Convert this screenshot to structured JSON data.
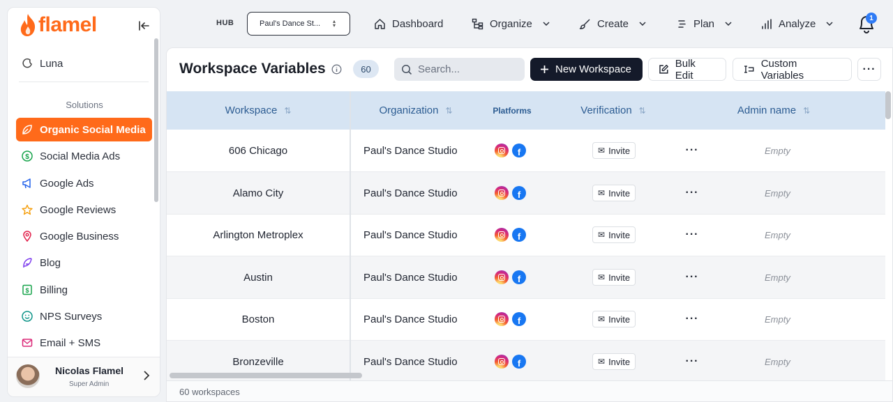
{
  "app": {
    "logo_text": "flamel",
    "brand_color": "#ff6a1a"
  },
  "sidebar": {
    "top_item": {
      "label": "Luna",
      "icon": "moon-icon"
    },
    "section_label": "Solutions",
    "items": [
      {
        "label": "Organic Social Media",
        "icon": "leaf-icon",
        "active": true
      },
      {
        "label": "Social Media Ads",
        "icon": "dollar-icon"
      },
      {
        "label": "Google Ads",
        "icon": "megaphone-icon"
      },
      {
        "label": "Google Reviews",
        "icon": "star-icon"
      },
      {
        "label": "Google Business",
        "icon": "map-pin-icon"
      },
      {
        "label": "Blog",
        "icon": "feather-icon"
      },
      {
        "label": "Billing",
        "icon": "bill-icon"
      },
      {
        "label": "NPS Surveys",
        "icon": "smile-icon"
      },
      {
        "label": "Email + SMS",
        "icon": "mail-icon"
      }
    ],
    "user": {
      "name": "Nicolas Flamel",
      "role": "Super Admin"
    }
  },
  "topbar": {
    "hub_label": "HUB",
    "hub_value": "Paul's Dance St...",
    "nav": [
      {
        "label": "Dashboard",
        "icon": "home-icon"
      },
      {
        "label": "Organize",
        "icon": "organize-icon"
      },
      {
        "label": "Create",
        "icon": "brush-icon"
      },
      {
        "label": "Plan",
        "icon": "list-icon"
      },
      {
        "label": "Analyze",
        "icon": "bar-chart-icon"
      }
    ],
    "notifications_count": "1"
  },
  "main": {
    "title": "Workspace Variables",
    "count": "60",
    "search_placeholder": "Search...",
    "buttons": {
      "new_workspace": "New Workspace",
      "bulk_edit": "Bulk Edit",
      "custom_variables": "Custom Variables"
    },
    "columns": [
      "Workspace",
      "Organization",
      "Platforms",
      "Verification",
      "Admin name"
    ],
    "rows": [
      {
        "workspace": "606 Chicago",
        "organization": "Paul's Dance Studio",
        "verification": "Invite",
        "admin": "Empty"
      },
      {
        "workspace": "Alamo City",
        "organization": "Paul's Dance Studio",
        "verification": "Invite",
        "admin": "Empty"
      },
      {
        "workspace": "Arlington Metroplex",
        "organization": "Paul's Dance Studio",
        "verification": "Invite",
        "admin": "Empty"
      },
      {
        "workspace": "Austin",
        "organization": "Paul's Dance Studio",
        "verification": "Invite",
        "admin": "Empty"
      },
      {
        "workspace": "Boston",
        "organization": "Paul's Dance Studio",
        "verification": "Invite",
        "admin": "Empty"
      },
      {
        "workspace": "Bronzeville",
        "organization": "Paul's Dance Studio",
        "verification": "Invite",
        "admin": "Empty"
      }
    ],
    "footer": "60 workspaces"
  }
}
